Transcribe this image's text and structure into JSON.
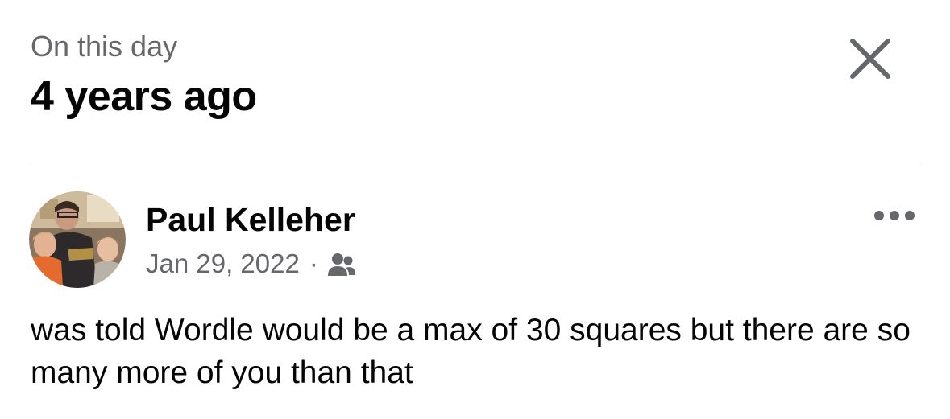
{
  "header": {
    "subtitle": "On this day",
    "title": "4 years ago"
  },
  "icons": {
    "close": "close-icon",
    "more": "more-icon",
    "audience": "friends-icon",
    "avatar": "profile-photo"
  },
  "post": {
    "author": "Paul Kelleher",
    "date": "Jan 29, 2022",
    "separator": "·",
    "text": "was told Wordle would be a max of 30 squares but there are so many more of you than that"
  },
  "colors": {
    "primary_text": "#050505",
    "secondary_text": "#65676b",
    "divider": "#dadde1",
    "icon": "#65676b"
  }
}
